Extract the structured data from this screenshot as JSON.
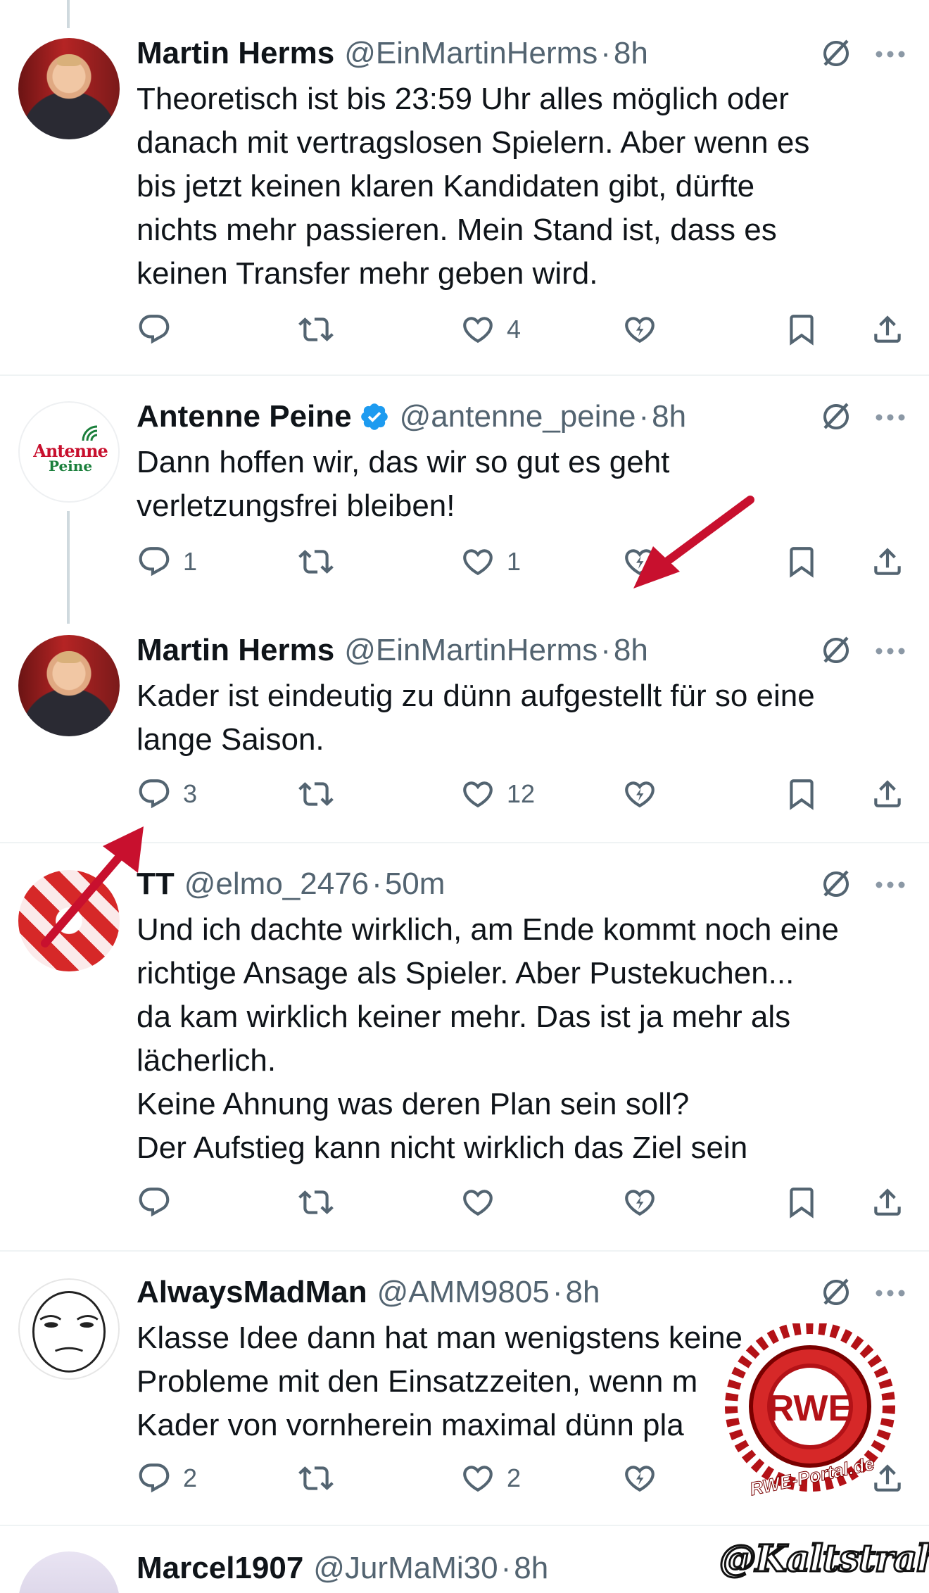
{
  "colors": {
    "text": "#0f1419",
    "muted": "#536471",
    "verified": "#1d9bf0",
    "arrow": "#c8102e",
    "separator": "#eff3f4"
  },
  "tweets": [
    {
      "name": "Martin Herms",
      "handle": "@EinMartinHerms",
      "time": "8h",
      "avatar": "portrait-photo",
      "text": "Theoretisch ist bis 23:59 Uhr alles möglich oder\ndanach mit vertragslosen Spielern. Aber wenn es\nbis jetzt keinen klaren Kandidaten gibt, dürfte\nnichts mehr passieren. Mein Stand ist, dass es\nkeinen Transfer mehr geben wird.",
      "replies": "",
      "retweets": "",
      "likes": "4"
    },
    {
      "name": "Antenne Peine",
      "handle": "@antenne_peine",
      "time": "8h",
      "verified": true,
      "avatar": "antenne-peine-logo",
      "avatar_line1": "Antenne",
      "avatar_line2": "Peine",
      "text": "Dann hoffen wir, das wir so gut es geht\nverletzungsfrei bleiben!",
      "replies": "1",
      "retweets": "",
      "likes": "1"
    },
    {
      "name": "Martin Herms",
      "handle": "@EinMartinHerms",
      "time": "8h",
      "avatar": "portrait-photo",
      "text": "Kader ist eindeutig zu dünn aufgestellt für so eine\nlange Saison.",
      "replies": "3",
      "retweets": "",
      "likes": "12"
    },
    {
      "name": "TT",
      "handle": "@elmo_2476",
      "time": "50m",
      "avatar": "rwe-stripes",
      "text": "Und ich dachte wirklich, am Ende kommt noch eine\nrichtige Ansage als Spieler. Aber Pustekuchen...\nda kam wirklich keiner mehr. Das ist ja mehr als\nlächerlich.\nKeine Ahnung was deren Plan sein soll?\nDer Aufstieg kann nicht wirklich das Ziel sein",
      "replies": "",
      "retweets": "",
      "likes": ""
    },
    {
      "name": "AlwaysMadMan",
      "handle": "@AMM9805",
      "time": "8h",
      "avatar": "meme-face",
      "text": "Klasse Idee dann hat man wenigstens keine\nProbleme mit den Einsatzzeiten, wenn m\nKader von vornherein maximal dünn pla",
      "replies": "2",
      "retweets": "",
      "likes": "2"
    },
    {
      "name": "Marcel1907",
      "handle": "@JurMaMi30",
      "time": "8h",
      "avatar": "partial"
    }
  ],
  "overlays": {
    "rwe_badge_text": "RWE-Portal.de",
    "rwe_badge_letters": "RWE",
    "signature": "@Kaltstrahl"
  }
}
